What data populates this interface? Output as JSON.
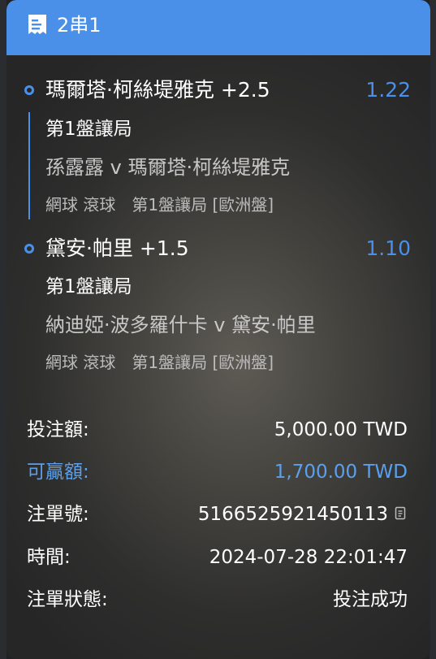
{
  "header": {
    "title": "2串1",
    "icon": "receipt-icon",
    "color": "#4a8fe8"
  },
  "selections": [
    {
      "name": "瑪爾塔·柯絲堤雅克 +2.5",
      "odds": "1.22",
      "market": "第1盤讓局",
      "match": "孫露露 v 瑪爾塔·柯絲堤雅克",
      "meta": "網球 滾球　第1盤讓局 [歐洲盤]"
    },
    {
      "name": "黛安·帕里 +1.5",
      "odds": "1.10",
      "market": "第1盤讓局",
      "match": "納迪婭·波多羅什卡 v 黛安·帕里",
      "meta": "網球 滾球　第1盤讓局 [歐洲盤]"
    }
  ],
  "summary": {
    "stake_label": "投注額:",
    "stake_value": "5,000.00 TWD",
    "win_label": "可贏額:",
    "win_value": "1,700.00 TWD",
    "ticket_label": "注單號:",
    "ticket_value": "5166525921450113",
    "time_label": "時間:",
    "time_value": "2024-07-28 22:01:47",
    "status_label": "注單狀態:",
    "status_value": "投注成功"
  },
  "accent_color": "#4a8fe8"
}
